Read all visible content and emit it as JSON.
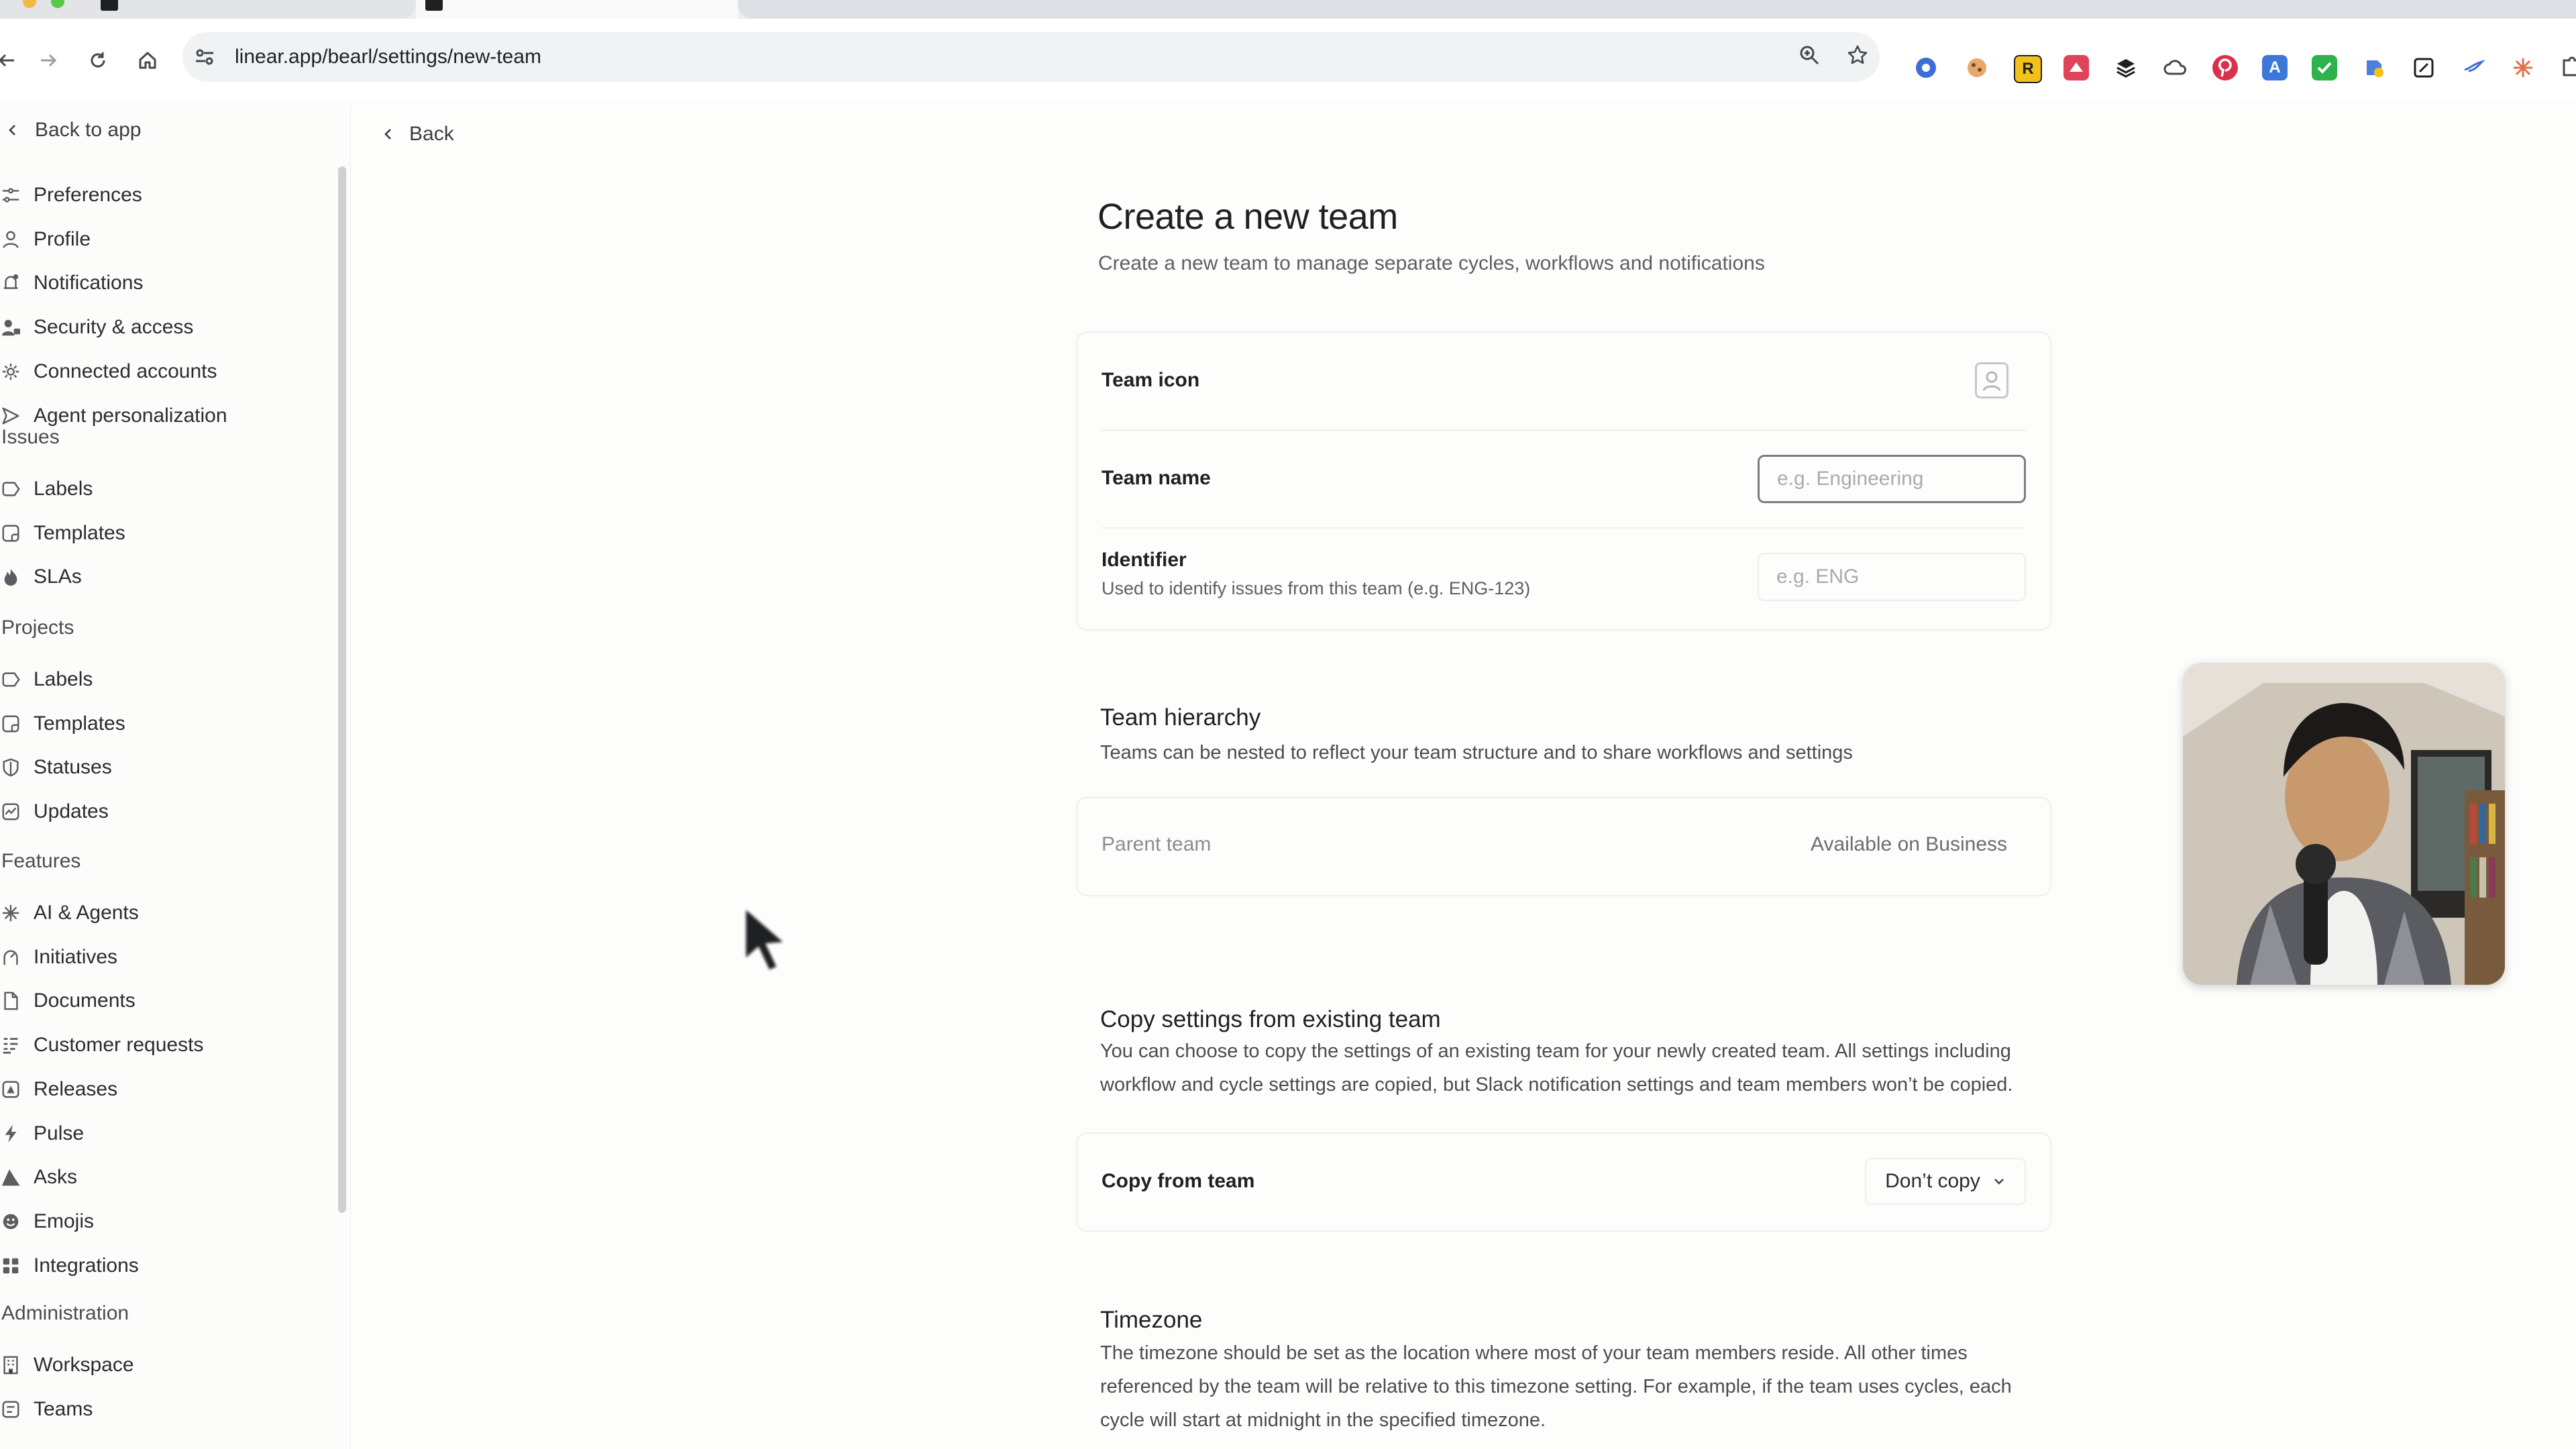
{
  "browser": {
    "url": "linear.app/bearl/settings/new-team",
    "extensions": [
      "chrome-profile-icon",
      "cookie-icon",
      "r-extension-icon",
      "cap-icon",
      "layers-icon",
      "cloud-icon",
      "pinterest-icon",
      "a-extension-icon",
      "check-extension-icon",
      "dropbox-icon",
      "edit-extension-icon",
      "bird-extension-icon",
      "sparkle-extension-icon",
      "puzzle-icon"
    ],
    "extension_letters": {
      "r": "R",
      "a": "A"
    }
  },
  "sidebar": {
    "back_label": "Back to app",
    "account_items": [
      {
        "label": "Preferences",
        "icon": "sliders-icon"
      },
      {
        "label": "Profile",
        "icon": "person-icon"
      },
      {
        "label": "Notifications",
        "icon": "bell-icon"
      },
      {
        "label": "Security & access",
        "icon": "people-lock-icon"
      },
      {
        "label": "Connected accounts",
        "icon": "gear-icon"
      },
      {
        "label": "Agent personalization",
        "icon": "send-icon"
      }
    ],
    "issues_heading": "Issues",
    "issues_items": [
      {
        "label": "Labels",
        "icon": "tag-icon"
      },
      {
        "label": "Templates",
        "icon": "template-icon"
      },
      {
        "label": "SLAs",
        "icon": "flame-icon"
      }
    ],
    "projects_heading": "Projects",
    "projects_items": [
      {
        "label": "Labels",
        "icon": "tag-icon"
      },
      {
        "label": "Templates",
        "icon": "template-icon"
      },
      {
        "label": "Statuses",
        "icon": "shield-icon"
      },
      {
        "label": "Updates",
        "icon": "pulse-square-icon"
      }
    ],
    "features_heading": "Features",
    "features_items": [
      {
        "label": "AI & Agents",
        "icon": "sparkle-icon"
      },
      {
        "label": "Initiatives",
        "icon": "initiative-icon"
      },
      {
        "label": "Documents",
        "icon": "document-icon"
      },
      {
        "label": "Customer requests",
        "icon": "list-icon"
      },
      {
        "label": "Releases",
        "icon": "release-icon"
      },
      {
        "label": "Pulse",
        "icon": "bolt-icon"
      },
      {
        "label": "Asks",
        "icon": "asks-icon"
      },
      {
        "label": "Emojis",
        "icon": "emoji-icon"
      },
      {
        "label": "Integrations",
        "icon": "grid-icon"
      }
    ],
    "admin_heading": "Administration",
    "admin_items": [
      {
        "label": "Workspace",
        "icon": "building-icon"
      },
      {
        "label": "Teams",
        "icon": "teams-icon"
      }
    ]
  },
  "main": {
    "back_label": "Back",
    "title": "Create a new team",
    "subtitle": "Create a new team to manage separate cycles, workflows and notifications",
    "team_card": {
      "icon_label": "Team icon",
      "name_label": "Team name",
      "name_placeholder": "e.g. Engineering",
      "name_value": "",
      "identifier_label": "Identifier",
      "identifier_desc": "Used to identify issues from this team (e.g. ENG-123)",
      "identifier_placeholder": "e.g. ENG",
      "identifier_value": ""
    },
    "hierarchy": {
      "title": "Team hierarchy",
      "desc": "Teams can be nested to reflect your team structure and to share workflows and settings",
      "parent_label": "Parent team",
      "parent_value": "Available on Business"
    },
    "copy": {
      "title": "Copy settings from existing team",
      "desc": "You can choose to copy the settings of an existing team for your newly created team. All settings including workflow and cycle settings are copied, but Slack notification settings and team members won’t be copied.",
      "label": "Copy from team",
      "value": "Don’t copy"
    },
    "timezone": {
      "title": "Timezone",
      "desc": "The timezone should be set as the location where most of your team members reside. All other times referenced by the team will be relative to this timezone setting. For example, if the team uses cycles, each cycle will start at midnight in the specified timezone."
    }
  },
  "colors": {
    "background": "#fcfcfb",
    "text": "#1f2023",
    "muted": "#5d5f64",
    "border": "#efefef"
  }
}
